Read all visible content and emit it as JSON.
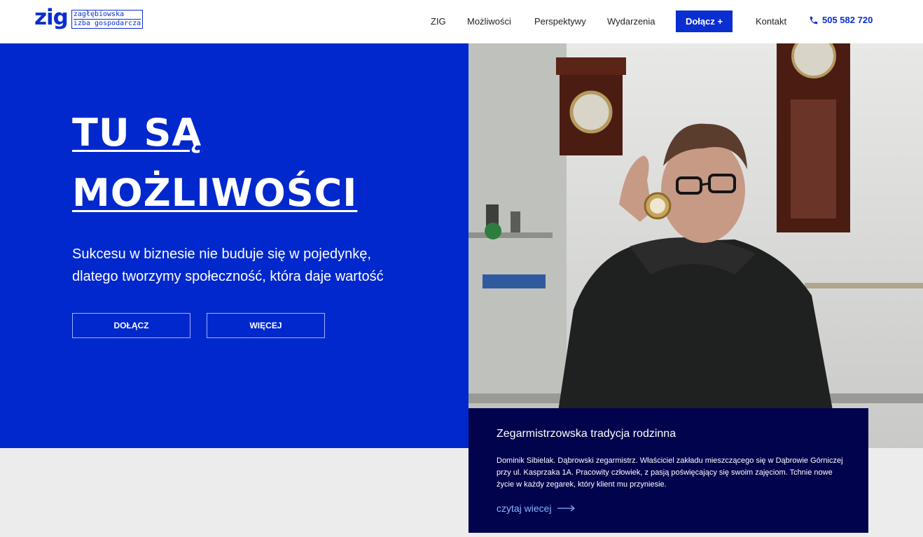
{
  "header": {
    "logo_mark": "zig",
    "logo_line1": "zagłębiowska",
    "logo_line2": "izba gospodarcza",
    "nav": [
      "ZIG",
      "Możliwości",
      "Perspektywy",
      "Wydarzenia"
    ],
    "cta": "Dołącz +",
    "contact": "Kontakt",
    "phone": "505 582 720"
  },
  "hero": {
    "title_line1": "TU SĄ",
    "title_line2": "MOŻLIWOŚCI",
    "subtitle": "Sukcesu w biznesie nie buduje się w pojedynkę, dlatego tworzymy społeczność, która daje wartość",
    "btn_join": "DOŁĄCZ",
    "btn_more": "WIĘCEJ"
  },
  "card": {
    "title": "Zegarmistrzowska tradycja rodzinna",
    "text": "Dominik Sibielak. Dąbrowski zegarmistrz. Właściciel zakładu mieszczącego się w Dąbrowie Górniczej przy ul. Kasprzaka 1A. Pracowity człowiek, z pasją poświęcający się swoim zajęciom. Tchnie nowe życie w każdy zegarek, który klient mu przyniesie.",
    "link": "czytaj wiecej"
  },
  "colors": {
    "brand_blue": "#0028cc",
    "card_navy": "#02034d",
    "link_blue": "#8ab3ff"
  }
}
